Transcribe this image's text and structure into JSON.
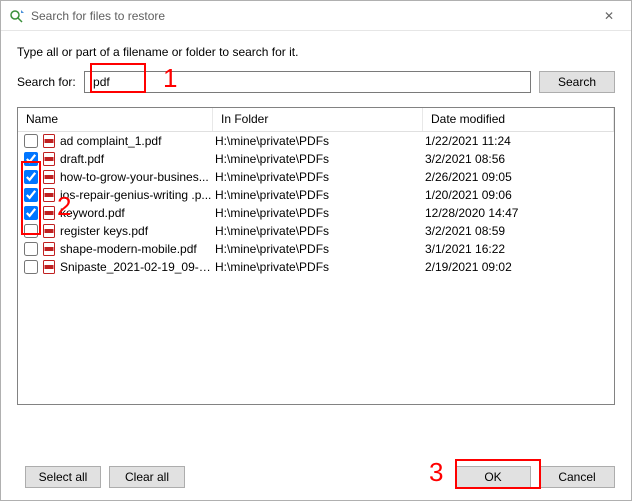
{
  "window": {
    "title": "Search for files to restore",
    "close_glyph": "✕"
  },
  "instruction": "Type all or part of a filename or folder to search for it.",
  "search": {
    "label": "Search for:",
    "value": ".pdf",
    "button": "Search"
  },
  "columns": {
    "name": "Name",
    "folder": "In Folder",
    "date": "Date modified"
  },
  "rows": [
    {
      "checked": false,
      "name": "ad complaint_1.pdf",
      "folder": "H:\\mine\\private\\PDFs",
      "date": "1/22/2021 11:24"
    },
    {
      "checked": true,
      "name": "draft.pdf",
      "folder": "H:\\mine\\private\\PDFs",
      "date": "3/2/2021 08:56"
    },
    {
      "checked": true,
      "name": "how-to-grow-your-busines...",
      "folder": "H:\\mine\\private\\PDFs",
      "date": "2/26/2021 09:05"
    },
    {
      "checked": true,
      "name": "ios-repair-genius-writing .p...",
      "folder": "H:\\mine\\private\\PDFs",
      "date": "1/20/2021 09:06"
    },
    {
      "checked": true,
      "name": "keyword.pdf",
      "folder": "H:\\mine\\private\\PDFs",
      "date": "12/28/2020 14:47"
    },
    {
      "checked": false,
      "name": "register keys.pdf",
      "folder": "H:\\mine\\private\\PDFs",
      "date": "3/2/2021 08:59"
    },
    {
      "checked": false,
      "name": "shape-modern-mobile.pdf",
      "folder": "H:\\mine\\private\\PDFs",
      "date": "3/1/2021 16:22"
    },
    {
      "checked": false,
      "name": "Snipaste_2021-02-19_09-02...",
      "folder": "H:\\mine\\private\\PDFs",
      "date": "2/19/2021 09:02"
    }
  ],
  "buttons": {
    "select_all": "Select all",
    "clear_all": "Clear all",
    "ok": "OK",
    "cancel": "Cancel"
  },
  "annotations": {
    "n1": "1",
    "n2": "2",
    "n3": "3"
  }
}
